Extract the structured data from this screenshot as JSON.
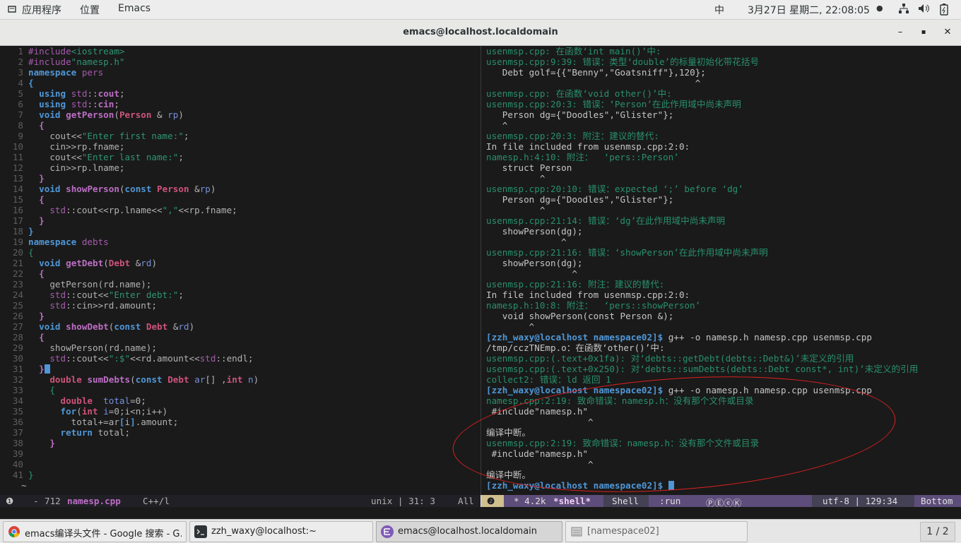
{
  "topbar": {
    "apps_menu": "应用程序",
    "places_menu": "位置",
    "emacs_menu": "Emacs",
    "input_method": "中",
    "clock": "3月27日 星期二, 22:08:05",
    "clock_dot": "●"
  },
  "window": {
    "title": "emacs@localhost.localdomain",
    "minimize": "–",
    "maximize": "▪",
    "close": "✕"
  },
  "editor": {
    "lines": [
      {
        "n": "1",
        "code": [
          [
            "pp",
            "#include"
          ],
          [
            "str",
            "<iostream>"
          ]
        ]
      },
      {
        "n": "2",
        "code": [
          [
            "pp",
            "#include"
          ],
          [
            "str",
            "\"namesp.h\""
          ]
        ]
      },
      {
        "n": "3",
        "code": [
          [
            "kw",
            "namespace"
          ],
          [
            "txt",
            " "
          ],
          [
            "ns",
            "pers"
          ]
        ]
      },
      {
        "n": "4",
        "code": [
          [
            "kw",
            "{"
          ]
        ]
      },
      {
        "n": "5",
        "code": [
          [
            "txt",
            "  "
          ],
          [
            "kw",
            "using"
          ],
          [
            "txt",
            " "
          ],
          [
            "ns",
            "std"
          ],
          [
            "txt",
            "::"
          ],
          [
            "fn",
            "cout"
          ],
          [
            "txt",
            ";"
          ]
        ]
      },
      {
        "n": "6",
        "code": [
          [
            "txt",
            "  "
          ],
          [
            "kw",
            "using"
          ],
          [
            "txt",
            " "
          ],
          [
            "ns",
            "std"
          ],
          [
            "txt",
            "::"
          ],
          [
            "fn",
            "cin"
          ],
          [
            "txt",
            ";"
          ]
        ]
      },
      {
        "n": "7",
        "code": [
          [
            "txt",
            "  "
          ],
          [
            "kw",
            "void"
          ],
          [
            "txt",
            " "
          ],
          [
            "fn",
            "getPerson"
          ],
          [
            "txt",
            "("
          ],
          [
            "ty",
            "Person"
          ],
          [
            "txt",
            " & "
          ],
          [
            "var",
            "rp"
          ],
          [
            "txt",
            ")"
          ]
        ]
      },
      {
        "n": "8",
        "code": [
          [
            "txt",
            "  "
          ],
          [
            "fn",
            "{"
          ]
        ]
      },
      {
        "n": "9",
        "code": [
          [
            "txt",
            "    cout<<"
          ],
          [
            "str",
            "\"Enter first name:\""
          ],
          [
            "txt",
            ";"
          ]
        ]
      },
      {
        "n": "10",
        "code": [
          [
            "txt",
            "    cin>>rp.fname;"
          ]
        ]
      },
      {
        "n": "11",
        "code": [
          [
            "txt",
            "    cout<<"
          ],
          [
            "str",
            "\"Enter last name:\""
          ],
          [
            "txt",
            ";"
          ]
        ]
      },
      {
        "n": "12",
        "code": [
          [
            "txt",
            "    cin>>rp.lname;"
          ]
        ]
      },
      {
        "n": "13",
        "code": [
          [
            "txt",
            "  "
          ],
          [
            "fn",
            "}"
          ]
        ]
      },
      {
        "n": "14",
        "code": [
          [
            "txt",
            "  "
          ],
          [
            "kw",
            "void"
          ],
          [
            "txt",
            " "
          ],
          [
            "fn",
            "showPerson"
          ],
          [
            "txt",
            "("
          ],
          [
            "kw",
            "const"
          ],
          [
            "txt",
            " "
          ],
          [
            "ty",
            "Person"
          ],
          [
            "txt",
            " &"
          ],
          [
            "var",
            "rp"
          ],
          [
            "txt",
            ")"
          ]
        ]
      },
      {
        "n": "15",
        "code": [
          [
            "txt",
            "  "
          ],
          [
            "fn",
            "{"
          ]
        ]
      },
      {
        "n": "16",
        "code": [
          [
            "txt",
            "    "
          ],
          [
            "ns",
            "std"
          ],
          [
            "txt",
            "::cout<<rp.lname<<"
          ],
          [
            "str",
            "\",\""
          ],
          [
            "txt",
            "<<rp.fname;"
          ]
        ]
      },
      {
        "n": "17",
        "code": [
          [
            "txt",
            "  "
          ],
          [
            "fn",
            "}"
          ]
        ]
      },
      {
        "n": "18",
        "code": [
          [
            "kw",
            "}"
          ]
        ]
      },
      {
        "n": "19",
        "code": [
          [
            "kw",
            "namespace"
          ],
          [
            "txt",
            " "
          ],
          [
            "ns",
            "debts"
          ]
        ]
      },
      {
        "n": "20",
        "code": [
          [
            "str",
            "{"
          ]
        ]
      },
      {
        "n": "21",
        "code": [
          [
            "txt",
            "  "
          ],
          [
            "kw",
            "void"
          ],
          [
            "txt",
            " "
          ],
          [
            "fn",
            "getDebt"
          ],
          [
            "txt",
            "("
          ],
          [
            "ty",
            "Debt"
          ],
          [
            "txt",
            " &"
          ],
          [
            "var",
            "rd"
          ],
          [
            "txt",
            ")"
          ]
        ]
      },
      {
        "n": "22",
        "code": [
          [
            "txt",
            "  "
          ],
          [
            "fn",
            "{"
          ]
        ]
      },
      {
        "n": "23",
        "code": [
          [
            "txt",
            "    getPerson(rd.name);"
          ]
        ]
      },
      {
        "n": "24",
        "code": [
          [
            "txt",
            "    "
          ],
          [
            "ns",
            "std"
          ],
          [
            "txt",
            "::cout<<"
          ],
          [
            "str",
            "\"Enter debt:\""
          ],
          [
            "txt",
            ";"
          ]
        ]
      },
      {
        "n": "25",
        "code": [
          [
            "txt",
            "    "
          ],
          [
            "ns",
            "std"
          ],
          [
            "txt",
            "::cin>>rd.amount;"
          ]
        ]
      },
      {
        "n": "26",
        "code": [
          [
            "txt",
            "  "
          ],
          [
            "fn",
            "}"
          ]
        ]
      },
      {
        "n": "27",
        "code": [
          [
            "txt",
            "  "
          ],
          [
            "kw",
            "void"
          ],
          [
            "txt",
            " "
          ],
          [
            "fn",
            "showDebt"
          ],
          [
            "txt",
            "("
          ],
          [
            "kw",
            "const"
          ],
          [
            "txt",
            " "
          ],
          [
            "ty",
            "Debt"
          ],
          [
            "txt",
            " &"
          ],
          [
            "var",
            "rd"
          ],
          [
            "txt",
            ")"
          ]
        ]
      },
      {
        "n": "28",
        "code": [
          [
            "txt",
            "  "
          ],
          [
            "fn",
            "{"
          ]
        ]
      },
      {
        "n": "29",
        "code": [
          [
            "txt",
            "    showPerson(rd.name);"
          ]
        ]
      },
      {
        "n": "30",
        "code": [
          [
            "txt",
            "    "
          ],
          [
            "ns",
            "std"
          ],
          [
            "txt",
            "::cout<<"
          ],
          [
            "str",
            "\":$\""
          ],
          [
            "txt",
            "<<rd.amount<<"
          ],
          [
            "ns",
            "std"
          ],
          [
            "txt",
            "::endl;"
          ]
        ]
      },
      {
        "n": "31",
        "code": [
          [
            "txt",
            "  "
          ],
          [
            "fn",
            "}"
          ],
          [
            "cur",
            ""
          ]
        ]
      },
      {
        "n": "32",
        "code": [
          [
            "txt",
            "    "
          ],
          [
            "ty",
            "double"
          ],
          [
            "txt",
            " "
          ],
          [
            "fn",
            "sumDebts"
          ],
          [
            "txt",
            "("
          ],
          [
            "kw",
            "const"
          ],
          [
            "txt",
            " "
          ],
          [
            "ty",
            "Debt"
          ],
          [
            "txt",
            " "
          ],
          [
            "var",
            "ar"
          ],
          [
            "txt",
            "[] ,"
          ],
          [
            "ty",
            "int"
          ],
          [
            "txt",
            " "
          ],
          [
            "var",
            "n"
          ],
          [
            "txt",
            ")"
          ]
        ]
      },
      {
        "n": "33",
        "code": [
          [
            "txt",
            "    "
          ],
          [
            "str",
            "{"
          ]
        ]
      },
      {
        "n": "34",
        "code": [
          [
            "txt",
            "      "
          ],
          [
            "ty",
            "double"
          ],
          [
            "txt",
            "  "
          ],
          [
            "var",
            "total"
          ],
          [
            "txt",
            "=0;"
          ]
        ]
      },
      {
        "n": "35",
        "code": [
          [
            "txt",
            "      "
          ],
          [
            "kw",
            "for"
          ],
          [
            "txt",
            "("
          ],
          [
            "ty",
            "int"
          ],
          [
            "txt",
            " "
          ],
          [
            "var",
            "i"
          ],
          [
            "txt",
            "=0;i<n;i++)"
          ]
        ]
      },
      {
        "n": "36",
        "code": [
          [
            "txt",
            "        total+=ar"
          ],
          [
            "kw",
            "["
          ],
          [
            "txt",
            "i"
          ],
          [
            "kw",
            "]"
          ],
          [
            "txt",
            ".amount;"
          ]
        ]
      },
      {
        "n": "37",
        "code": [
          [
            "txt",
            "      "
          ],
          [
            "kw",
            "return"
          ],
          [
            "txt",
            " total;"
          ]
        ]
      },
      {
        "n": "38",
        "code": [
          [
            "txt",
            "    "
          ],
          [
            "fn",
            "}"
          ]
        ]
      },
      {
        "n": "39",
        "code": []
      },
      {
        "n": "40",
        "code": []
      },
      {
        "n": "41",
        "code": [
          [
            "str",
            "}"
          ]
        ]
      },
      {
        "n": "",
        "code": [
          [
            "txt",
            "~"
          ]
        ]
      }
    ]
  },
  "shell": {
    "lines": [
      [
        [
          "grn",
          "usenmsp.cpp: 在函数‘int main()’中:"
        ]
      ],
      [
        [
          "grn",
          "usenmsp.cpp:9:39: 错误：类型‘double’的标量初始化带花括号"
        ]
      ],
      [
        [
          "wht",
          "   Debt golf={{\"Benny\",\"Goatsniff\"},120};"
        ]
      ],
      [
        [
          "wht",
          "                                       ^"
        ]
      ],
      [
        [
          "grn",
          "usenmsp.cpp: 在函数‘void other()’中:"
        ]
      ],
      [
        [
          "grn",
          "usenmsp.cpp:20:3: 错误：‘Person’在此作用域中尚未声明"
        ]
      ],
      [
        [
          "wht",
          "   Person dg={\"Doodles\",\"Glister\"};"
        ]
      ],
      [
        [
          "wht",
          "   ^"
        ]
      ],
      [
        [
          "grn",
          "usenmsp.cpp:20:3: 附注：建议的替代:"
        ]
      ],
      [
        [
          "wht",
          "In file included from usenmsp.cpp:2:0:"
        ]
      ],
      [
        [
          "grn",
          "namesp.h:4:10: 附注：  ‘pers::Person’"
        ]
      ],
      [
        [
          "wht",
          "   struct Person"
        ]
      ],
      [
        [
          "wht",
          "          ^"
        ]
      ],
      [
        [
          "grn",
          "usenmsp.cpp:20:10: 错误：expected ‘;’ before ‘dg’"
        ]
      ],
      [
        [
          "wht",
          "   Person dg={\"Doodles\",\"Glister\"};"
        ]
      ],
      [
        [
          "wht",
          "          ^"
        ]
      ],
      [
        [
          "grn",
          "usenmsp.cpp:21:14: 错误：‘dg’在此作用域中尚未声明"
        ]
      ],
      [
        [
          "wht",
          "   showPerson(dg);"
        ]
      ],
      [
        [
          "wht",
          "              ^"
        ]
      ],
      [
        [
          "grn",
          "usenmsp.cpp:21:16: 错误：‘showPerson’在此作用域中尚未声明"
        ]
      ],
      [
        [
          "wht",
          "   showPerson(dg);"
        ]
      ],
      [
        [
          "wht",
          "                ^"
        ]
      ],
      [
        [
          "grn",
          "usenmsp.cpp:21:16: 附注：建议的替代:"
        ]
      ],
      [
        [
          "wht",
          "In file included from usenmsp.cpp:2:0:"
        ]
      ],
      [
        [
          "grn",
          "namesp.h:10:8: 附注：  ‘pers::showPerson’"
        ]
      ],
      [
        [
          "wht",
          "   void showPerson(const Person &);"
        ]
      ],
      [
        [
          "wht",
          "        ^"
        ]
      ],
      [
        [
          "prm",
          "[zzh_waxy@localhost namespace02]$ "
        ],
        [
          "wht",
          "g++ -o namesp.h namesp.cpp usenmsp.cpp"
        ]
      ],
      [
        [
          "wht",
          "/tmp/cczTNEmp.o：在函数‘other()’中:"
        ]
      ],
      [
        [
          "grn",
          "usenmsp.cpp:(.text+0x1fa): 对‘debts::getDebt(debts::Debt&)’未定义的引用"
        ]
      ],
      [
        [
          "grn",
          "usenmsp.cpp:(.text+0x250): 对‘debts::sumDebts(debts::Debt const*, int)’未定义的引用"
        ]
      ],
      [
        [
          "grn",
          "collect2: 错误：ld 返回 1"
        ]
      ],
      [
        [
          "prm",
          "[zzh_waxy@localhost namespace02]$ "
        ],
        [
          "wht",
          "g++ -o namesp.h namesp.cpp usenmsp.cpp"
        ]
      ],
      [
        [
          "grn",
          "namesp.cpp:2:19: 致命错误：namesp.h：没有那个文件或目录"
        ]
      ],
      [
        [
          "wht",
          " #include\"namesp.h\""
        ]
      ],
      [
        [
          "wht",
          "                   ^"
        ]
      ],
      [
        [
          "wht",
          "编译中断。"
        ]
      ],
      [
        [
          "grn",
          "usenmsp.cpp:2:19: 致命错误：namesp.h：没有那个文件或目录"
        ]
      ],
      [
        [
          "wht",
          " #include\"namesp.h\""
        ]
      ],
      [
        [
          "wht",
          "                   ^"
        ]
      ],
      [
        [
          "wht",
          "编译中断。"
        ]
      ],
      [
        [
          "prm",
          "[zzh_waxy@localhost namespace02]$ "
        ],
        [
          "cur",
          ""
        ]
      ]
    ]
  },
  "modeline_left": {
    "info_icon": "❶",
    "dash": "-",
    "size": "712",
    "buffer": "namesp.cpp",
    "mode": "C++/l",
    "eol": "unix | 31: 3",
    "pos": "All"
  },
  "modeline_right": {
    "window_num": "❷",
    "state": "* 4.2k",
    "buffer": "*shell*",
    "mode": "Shell",
    "process": ":run",
    "minor": "ⓅⒺⓔⓀ",
    "enc": "utf-8 | 129:34",
    "pos": "Bottom"
  },
  "taskbar": {
    "tasks": [
      {
        "label": "emacs编译头文件 - Google 搜索 - G…"
      },
      {
        "label": "zzh_waxy@localhost:~"
      },
      {
        "label": "emacs@localhost.localdomain"
      },
      {
        "label": "[namespace02]"
      }
    ],
    "pager": "1 / 2"
  },
  "colors": {
    "editor_bg": "#1a1a1a",
    "modeline_bg": "#212026",
    "keyword": "#4f97d7",
    "string": "#2d9574",
    "annotation": "#e02020"
  }
}
